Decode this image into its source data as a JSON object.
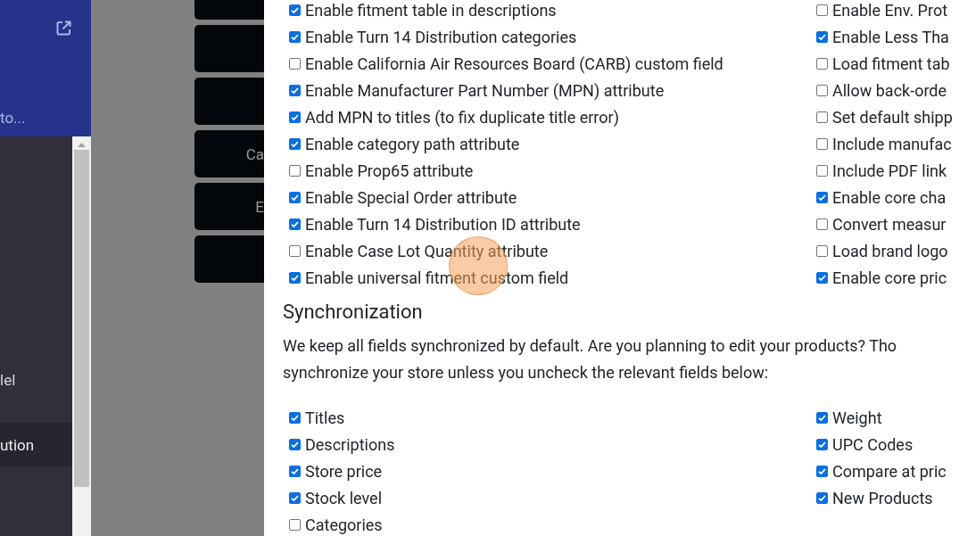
{
  "sidebar": {
    "header_text": "to...",
    "items": [
      {
        "label": "lel",
        "selected": false
      },
      {
        "label": "ution",
        "selected": true
      }
    ]
  },
  "background_buttons": [
    {
      "kind": "blank"
    },
    {
      "kind": "blank"
    },
    {
      "kind": "blank"
    },
    {
      "kind": "label",
      "label": "Ca"
    },
    {
      "kind": "label",
      "label": "E"
    },
    {
      "kind": "blank"
    }
  ],
  "options": {
    "left": [
      {
        "label": "Enable fitment table in descriptions",
        "checked": true
      },
      {
        "label": "Enable Turn 14 Distribution categories",
        "checked": true
      },
      {
        "label": "Enable California Air Resources Board (CARB) custom field",
        "checked": false
      },
      {
        "label": "Enable Manufacturer Part Number (MPN) attribute",
        "checked": true
      },
      {
        "label": "Add MPN to titles (to fix duplicate title error)",
        "checked": true
      },
      {
        "label": "Enable category path attribute",
        "checked": true
      },
      {
        "label": "Enable Prop65 attribute",
        "checked": false
      },
      {
        "label": "Enable Special Order attribute",
        "checked": true
      },
      {
        "label": "Enable Turn 14 Distribution ID attribute",
        "checked": true
      },
      {
        "label": "Enable Case Lot Quantity attribute",
        "checked": false
      },
      {
        "label": "Enable universal fitment custom field",
        "checked": true
      }
    ],
    "right": [
      {
        "label": "Enable Env. Prot",
        "checked": false
      },
      {
        "label": "Enable Less Tha",
        "checked": true
      },
      {
        "label": "Load fitment tab",
        "checked": false
      },
      {
        "label": "Allow back-orde",
        "checked": false
      },
      {
        "label": "Set default shipp",
        "checked": false
      },
      {
        "label": "Include manufac",
        "checked": false
      },
      {
        "label": "Include PDF link",
        "checked": false
      },
      {
        "label": "Enable core cha",
        "checked": true
      },
      {
        "label": "Convert measur",
        "checked": false
      },
      {
        "label": "Load brand logo",
        "checked": false
      },
      {
        "label": "Enable core pric",
        "checked": true
      }
    ]
  },
  "synchronization": {
    "heading": "Synchronization",
    "description": "We keep all fields synchronized by default. Are you planning to edit your products? Tho\nsynchronize your store unless you uncheck the relevant fields below:",
    "left": [
      {
        "label": "Titles",
        "checked": true
      },
      {
        "label": "Descriptions",
        "checked": true
      },
      {
        "label": "Store price",
        "checked": true
      },
      {
        "label": "Stock level",
        "checked": true
      },
      {
        "label": "Categories",
        "checked": false
      }
    ],
    "right": [
      {
        "label": "Weight",
        "checked": true
      },
      {
        "label": "UPC Codes",
        "checked": true
      },
      {
        "label": "Compare at pric",
        "checked": true
      },
      {
        "label": "New Products",
        "checked": true
      }
    ]
  }
}
